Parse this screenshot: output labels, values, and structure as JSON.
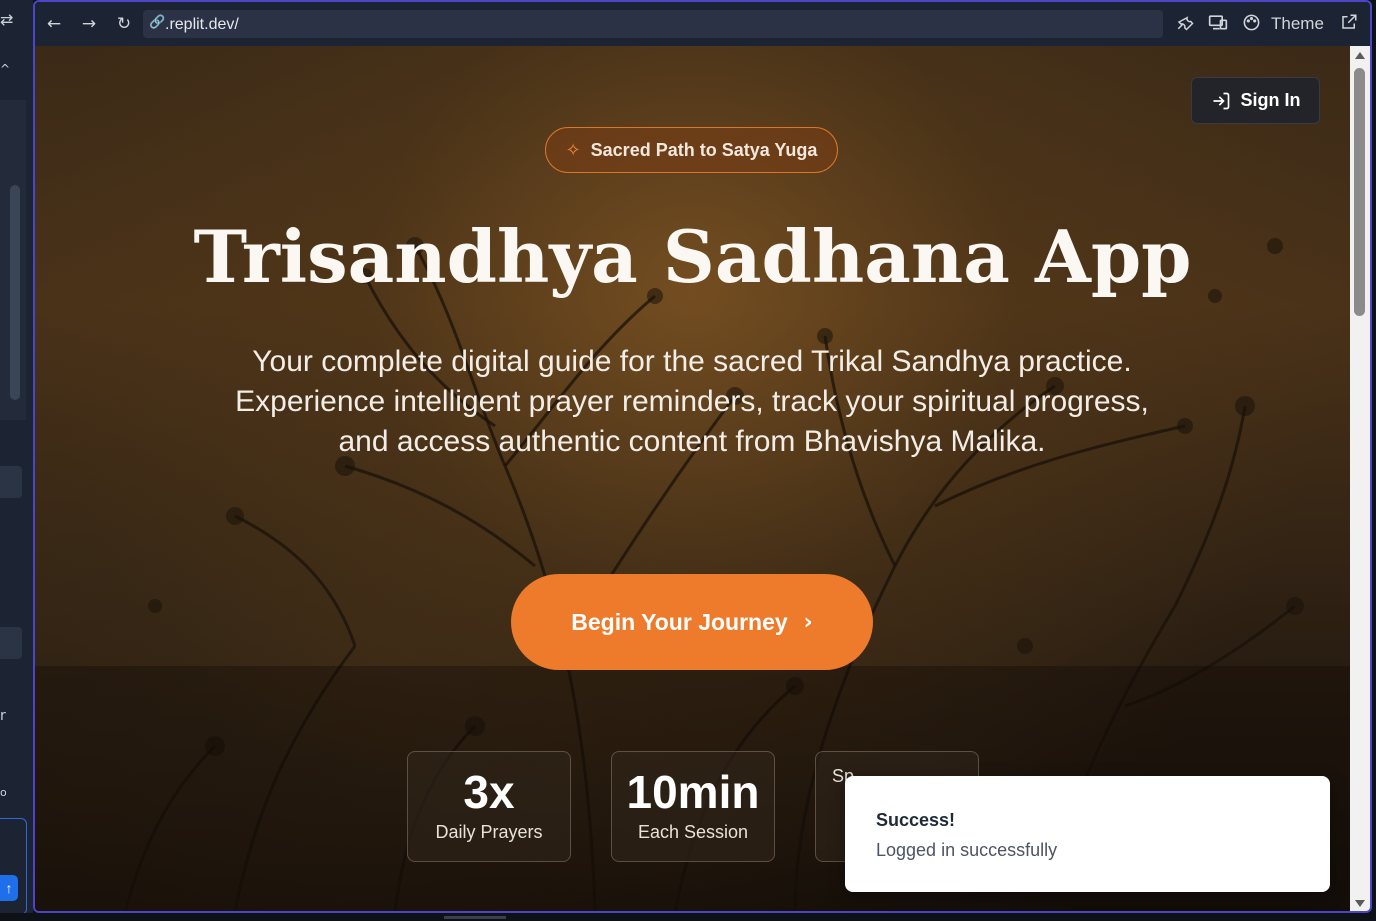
{
  "browser": {
    "url": ".replit.dev/",
    "theme_label": "Theme",
    "icons": [
      "back-icon",
      "forward-icon",
      "reload-icon",
      "link-icon",
      "wrench-icon",
      "devices-icon",
      "palette-icon",
      "external-link-icon"
    ]
  },
  "page": {
    "signin_label": "Sign In",
    "badge_label": "Sacred Path to Satya Yuga",
    "title": "Trisandhya Sadhana App",
    "subtitle": "Your complete digital guide for the sacred Trikal Sandhya practice. Experience intelligent prayer reminders, track your spiritual progress, and access authentic content from Bhavishya Malika.",
    "cta_label": "Begin Your Journey",
    "stats": [
      {
        "value": "3x",
        "label": "Daily Prayers"
      },
      {
        "value": "10min",
        "label": "Each Session"
      },
      {
        "value": "",
        "label": "Sp"
      }
    ]
  },
  "toast": {
    "title": "Success!",
    "message": "Logged in successfully"
  },
  "colors": {
    "accent": "#ee7a2c",
    "frame_border": "#4b45c9",
    "toolbar_bg": "#1c2333"
  }
}
